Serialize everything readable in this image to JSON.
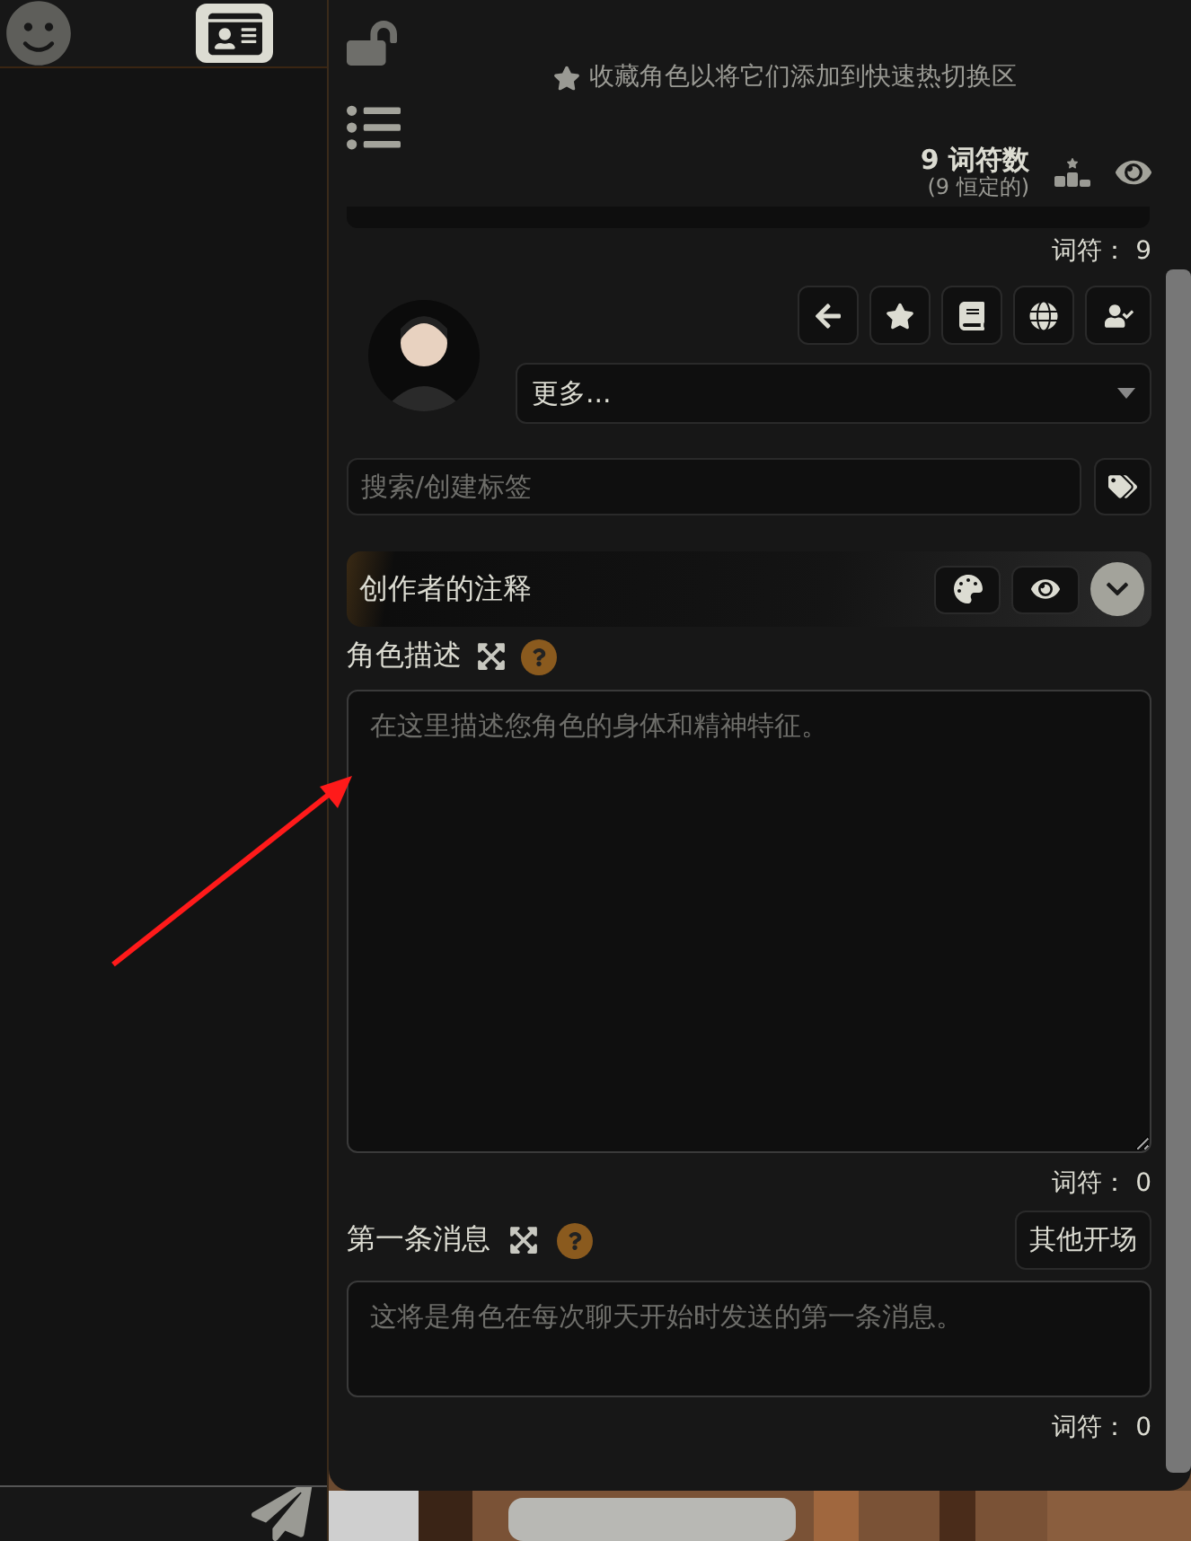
{
  "favorites_hint": {
    "text": "收藏角色以将它们添加到快速热切换区"
  },
  "token_summary": {
    "total": "9 词符数",
    "permanent": "(9 恒定的)"
  },
  "name_token_count": "词符： 9",
  "dropdown": {
    "value": "更多..."
  },
  "tag_search": {
    "placeholder": "搜索/创建标签"
  },
  "creator_notes": {
    "title": "创作者的注释"
  },
  "description": {
    "label": "角色描述",
    "placeholder": "在这里描述您角色的身体和精神特征。",
    "token_count": "词符： 0"
  },
  "first_message": {
    "label": "第一条消息",
    "button": "其他开场",
    "placeholder": "这将是角色在每次聊天开始时发送的第一条消息。",
    "token_count": "词符： 0"
  }
}
